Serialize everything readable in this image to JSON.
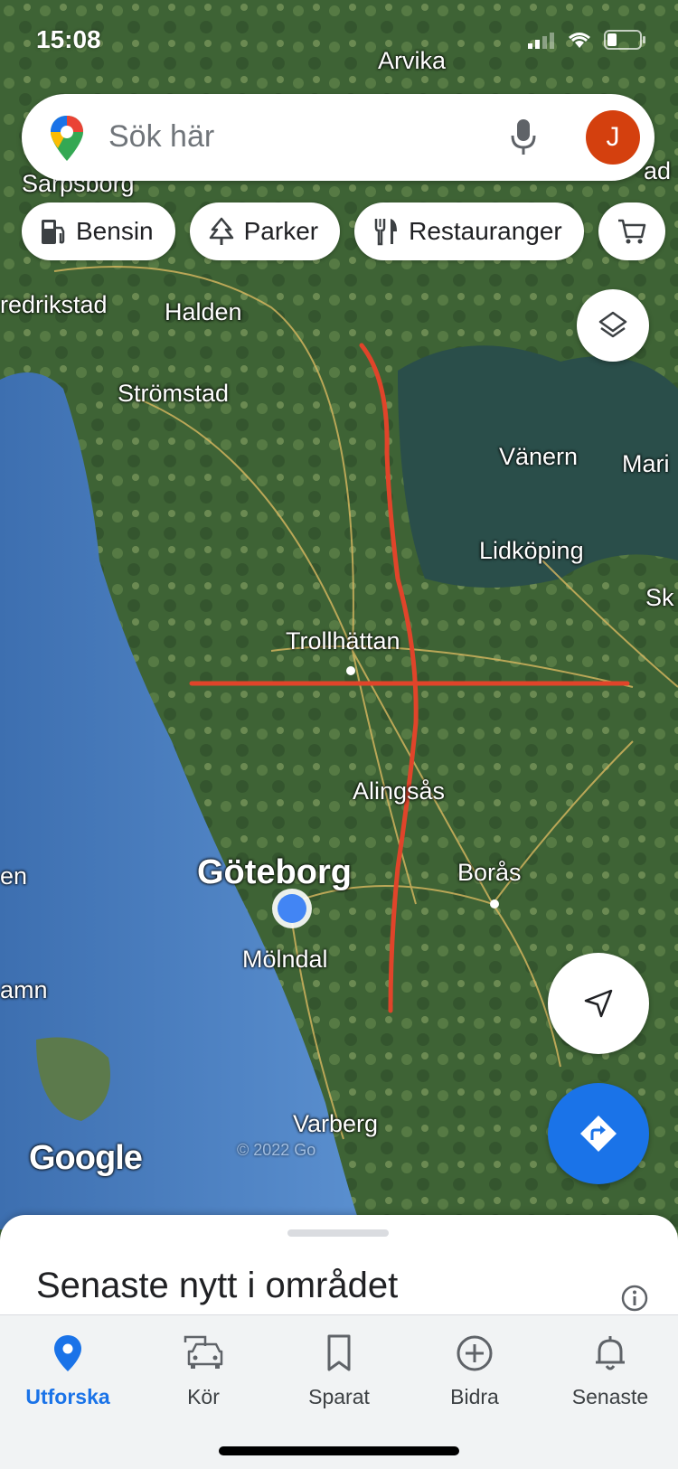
{
  "status_bar": {
    "time": "15:08"
  },
  "search": {
    "placeholder": "Sök här",
    "avatar_initial": "J"
  },
  "chips": [
    {
      "label": "Bensin",
      "icon": "gas-station-icon"
    },
    {
      "label": "Parker",
      "icon": "tree-icon"
    },
    {
      "label": "Restauranger",
      "icon": "restaurant-icon"
    },
    {
      "label": "",
      "icon": "cart-icon"
    }
  ],
  "map": {
    "labels": [
      "Arvika",
      "Sarpsborg",
      "redrikstad",
      "Halden",
      "Strömstad",
      "Vänern",
      "Mari",
      "Lidköping",
      "Sk",
      "Trollhättan",
      "Alingsås",
      "Göteborg",
      "Borås",
      "Mölndal",
      "en",
      "amn",
      "Varberg",
      "ad"
    ],
    "attribution": "Google",
    "copyright": "© 2022 Go",
    "colors": {
      "annotation_line": "#e0442a",
      "location_dot": "#4285f4"
    }
  },
  "sheet": {
    "title": "Senaste nytt i området"
  },
  "nav": [
    {
      "label": "Utforska",
      "icon": "location-pin-icon",
      "active": true
    },
    {
      "label": "Kör",
      "icon": "car-icon",
      "active": false
    },
    {
      "label": "Sparat",
      "icon": "bookmark-icon",
      "active": false
    },
    {
      "label": "Bidra",
      "icon": "add-circle-icon",
      "active": false
    },
    {
      "label": "Senaste",
      "icon": "bell-icon",
      "active": false
    }
  ],
  "colors": {
    "accent": "#1a73e8",
    "avatar": "#d4400e"
  }
}
